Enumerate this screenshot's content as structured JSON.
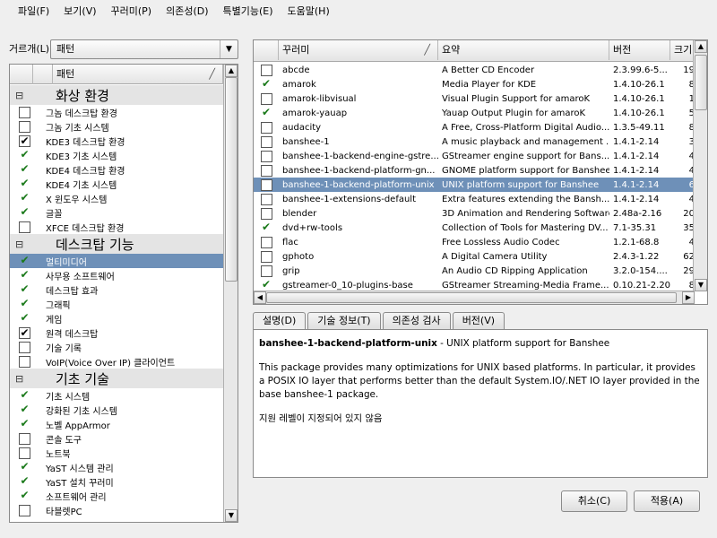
{
  "menu": [
    "파일(F)",
    "보기(V)",
    "꾸러미(P)",
    "의존성(D)",
    "특별기능(E)",
    "도움말(H)"
  ],
  "filter": {
    "label": "거르개(L):",
    "value": "패턴"
  },
  "patterns": {
    "header": "패턴",
    "items": [
      {
        "type": "cat",
        "label": "화상 환경"
      },
      {
        "type": "item",
        "check": "box",
        "label": "그놈 데스크탑 환경"
      },
      {
        "type": "item",
        "check": "box",
        "label": "그놈 기초 시스템"
      },
      {
        "type": "item",
        "check": "boxcheck",
        "label": "KDE3 데스크탑 환경"
      },
      {
        "type": "item",
        "check": "auto",
        "label": "KDE3 기초 시스템"
      },
      {
        "type": "item",
        "check": "auto",
        "label": "KDE4 데스크탑 환경"
      },
      {
        "type": "item",
        "check": "auto",
        "label": "KDE4 기초 시스템"
      },
      {
        "type": "item",
        "check": "auto",
        "label": "X 윈도우 시스템"
      },
      {
        "type": "item",
        "check": "auto",
        "label": "글꼴"
      },
      {
        "type": "item",
        "check": "box",
        "label": "XFCE 데스크탑 환경"
      },
      {
        "type": "cat",
        "label": "데스크탑 기능"
      },
      {
        "type": "item",
        "check": "auto",
        "label": "멀티미디어",
        "selected": true
      },
      {
        "type": "item",
        "check": "auto",
        "label": "사무용 소프트웨어"
      },
      {
        "type": "item",
        "check": "auto",
        "label": "데스크탑 효과"
      },
      {
        "type": "item",
        "check": "auto",
        "label": "그래픽"
      },
      {
        "type": "item",
        "check": "auto",
        "label": "게임"
      },
      {
        "type": "item",
        "check": "boxcheck",
        "label": "원격 데스크탑"
      },
      {
        "type": "item",
        "check": "box",
        "label": "기술 기록"
      },
      {
        "type": "item",
        "check": "box",
        "label": "VoIP(Voice Over IP) 클라이언트"
      },
      {
        "type": "cat",
        "label": "기초 기술"
      },
      {
        "type": "item",
        "check": "auto",
        "label": "기초 시스템"
      },
      {
        "type": "item",
        "check": "auto",
        "label": "강화된 기초 시스템"
      },
      {
        "type": "item",
        "check": "auto",
        "label": "노벨 AppArmor"
      },
      {
        "type": "item",
        "check": "box",
        "label": "콘솔 도구"
      },
      {
        "type": "item",
        "check": "box",
        "label": "노트북"
      },
      {
        "type": "item",
        "check": "auto",
        "label": "YaST 시스템 관리"
      },
      {
        "type": "item",
        "check": "auto",
        "label": "YaST 설치 꾸러미"
      },
      {
        "type": "item",
        "check": "auto",
        "label": "소프트웨어 관리"
      },
      {
        "type": "item",
        "check": "box",
        "label": "타블렛PC"
      }
    ]
  },
  "packages": {
    "headers": [
      "꾸러미",
      "요약",
      "버전",
      "크기"
    ],
    "rows": [
      {
        "check": "box",
        "name": "abcde",
        "summary": "A Better CD Encoder",
        "version": "2.3.99.6-5...",
        "size": "19"
      },
      {
        "check": "auto",
        "name": "amarok",
        "summary": "Media Player for KDE",
        "version": "1.4.10-26.1",
        "size": "8"
      },
      {
        "check": "box",
        "name": "amarok-libvisual",
        "summary": "Visual Plugin Support for amaroK",
        "version": "1.4.10-26.1",
        "size": "1"
      },
      {
        "check": "auto",
        "name": "amarok-yauap",
        "summary": "Yauap Output Plugin for amaroK",
        "version": "1.4.10-26.1",
        "size": "5"
      },
      {
        "check": "box",
        "name": "audacity",
        "summary": "A Free, Cross-Platform Digital Audio...",
        "version": "1.3.5-49.11",
        "size": "8"
      },
      {
        "check": "box",
        "name": "banshee-1",
        "summary": "A music playback and management ...",
        "version": "1.4.1-2.14",
        "size": "3"
      },
      {
        "check": "box",
        "name": "banshee-1-backend-engine-gstre...",
        "summary": "GStreamer engine support for Bans...",
        "version": "1.4.1-2.14",
        "size": "4"
      },
      {
        "check": "box",
        "name": "banshee-1-backend-platform-gn...",
        "summary": "GNOME platform support for Banshee",
        "version": "1.4.1-2.14",
        "size": "4"
      },
      {
        "check": "box",
        "name": "banshee-1-backend-platform-unix",
        "summary": "UNIX platform support for Banshee",
        "version": "1.4.1-2.14",
        "size": "6",
        "selected": true
      },
      {
        "check": "box",
        "name": "banshee-1-extensions-default",
        "summary": "Extra features extending the Bansh...",
        "version": "1.4.1-2.14",
        "size": "4"
      },
      {
        "check": "box",
        "name": "blender",
        "summary": "3D Animation and Rendering Software",
        "version": "2.48a-2.16",
        "size": "20"
      },
      {
        "check": "auto",
        "name": "dvd+rw-tools",
        "summary": "Collection of Tools for Mastering DV...",
        "version": "7.1-35.31",
        "size": "35"
      },
      {
        "check": "box",
        "name": "flac",
        "summary": "Free Lossless Audio Codec",
        "version": "1.2.1-68.8",
        "size": "4"
      },
      {
        "check": "box",
        "name": "gphoto",
        "summary": "A Digital Camera Utility",
        "version": "2.4.3-1.22",
        "size": "62"
      },
      {
        "check": "box",
        "name": "grip",
        "summary": "An Audio CD Ripping Application",
        "version": "3.2.0-154....",
        "size": "29"
      },
      {
        "check": "auto",
        "name": "gstreamer-0_10-plugins-base",
        "summary": "GStreamer Streaming-Media Frame...",
        "version": "0.10.21-2.20",
        "size": "8"
      }
    ]
  },
  "tabs": [
    "설명(D)",
    "기술 정보(T)",
    "의존성 검사",
    "버전(V)"
  ],
  "description": {
    "name": "banshee-1-backend-platform-unix",
    "summary_suffix": " - UNIX platform support for Banshee",
    "body": "This package provides many optimizations for UNIX based platforms. In particular, it provides a POSIX IO layer that performs better than the default System.IO/.NET IO layer provided in the base banshee-1 package.",
    "support": "지원 레벨이 지정되어 있지 않음"
  },
  "buttons": {
    "cancel": "취소(C)",
    "apply": "적용(A)"
  }
}
